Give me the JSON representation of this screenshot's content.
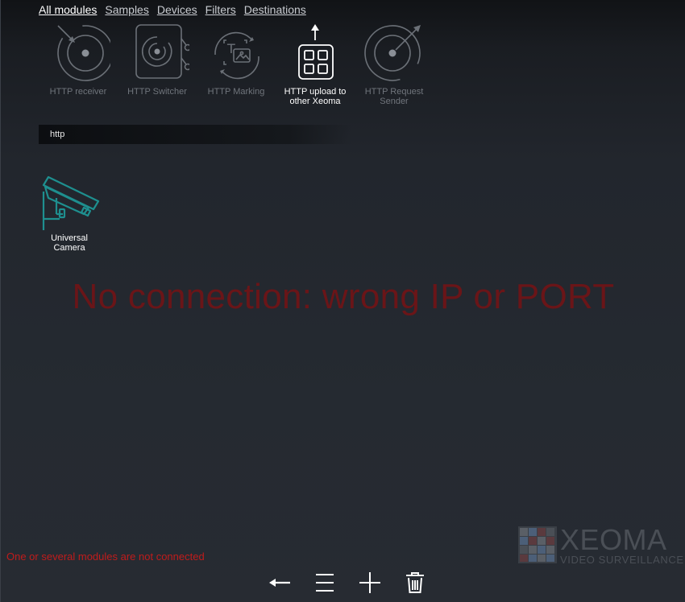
{
  "tabs": [
    {
      "label": "All modules",
      "active": true
    },
    {
      "label": "Samples",
      "active": false
    },
    {
      "label": "Devices",
      "active": false
    },
    {
      "label": "Filters",
      "active": false
    },
    {
      "label": "Destinations",
      "active": false
    }
  ],
  "modules": [
    {
      "label": "HTTP receiver",
      "icon": "http-receiver-icon"
    },
    {
      "label": "HTTP Switcher",
      "icon": "http-switcher-icon"
    },
    {
      "label": "HTTP Marking",
      "icon": "http-marking-icon"
    },
    {
      "label": "HTTP upload to other Xeoma",
      "icon": "http-upload-icon",
      "selected": true
    },
    {
      "label": "HTTP Request Sender",
      "icon": "http-request-sender-icon"
    }
  ],
  "search": {
    "value": "http"
  },
  "chain": {
    "camera_label": "Universal Camera"
  },
  "error": {
    "message": "No connection: wrong IP or PORT"
  },
  "status": {
    "text": "One or several modules are not connected"
  },
  "logo": {
    "name": "XEOMA",
    "tagline": "VIDEO SURVEILLANCE"
  },
  "colors": {
    "error_text": "#6a1518",
    "status_text": "#c01c1c",
    "camera_accent": "#1e8f8f",
    "logo_grey": "#4a4f56"
  }
}
